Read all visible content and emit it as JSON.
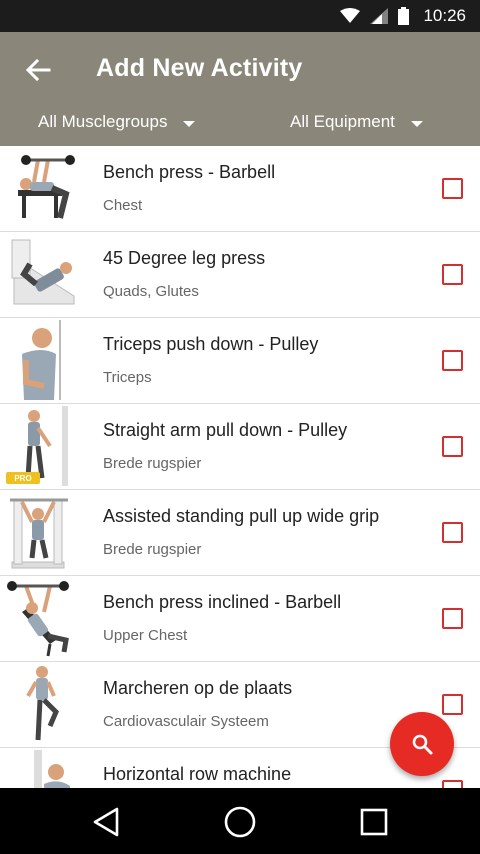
{
  "status_bar": {
    "time": "10:26",
    "icons": [
      "wifi-icon",
      "signal-icon",
      "battery-icon"
    ]
  },
  "app_bar": {
    "title": "Add New Activity",
    "back_icon": "arrow-left-icon",
    "filters": {
      "musclegroups": "All Musclegroups",
      "equipment": "All Equipment"
    }
  },
  "activities": [
    {
      "name": "Bench press - Barbell",
      "muscles": "Chest",
      "checked": false
    },
    {
      "name": "45 Degree leg press",
      "muscles": "Quads, Glutes",
      "checked": false
    },
    {
      "name": "Triceps push down - Pulley",
      "muscles": "Triceps",
      "checked": false
    },
    {
      "name": "Straight arm pull down - Pulley",
      "muscles": "Brede rugspier",
      "checked": false,
      "badge": "PRO"
    },
    {
      "name": "Assisted standing pull up wide grip",
      "muscles": "Brede rugspier",
      "checked": false
    },
    {
      "name": "Bench press inclined - Barbell",
      "muscles": "Upper Chest",
      "checked": false
    },
    {
      "name": "Marcheren op de plaats",
      "muscles": "Cardiovasculair Systeem",
      "checked": false
    },
    {
      "name": "Horizontal row machine",
      "muscles": "",
      "checked": false
    }
  ],
  "fab": {
    "icon": "search-icon"
  },
  "nav_bar": {
    "icons": [
      "back-triangle-icon",
      "home-circle-icon",
      "recents-square-icon"
    ]
  },
  "colors": {
    "app_bar": "#8a8679",
    "accent": "#e52b24",
    "checkbox": "#d32f2f"
  }
}
